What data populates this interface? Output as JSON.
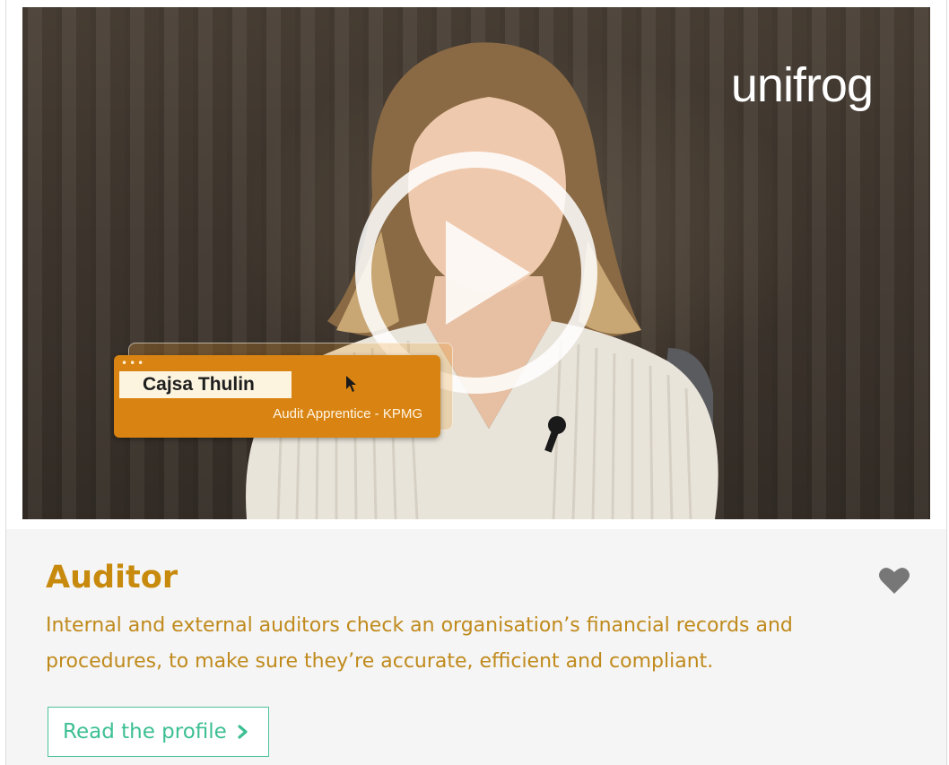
{
  "video": {
    "brand_logo": "unifrog",
    "lower_third": {
      "name": "Cajsa Thulin",
      "role": "Audit Apprentice - KPMG",
      "accent_color": "#d98412"
    },
    "play_icon": "play-circle-icon"
  },
  "profile": {
    "title": "Auditor",
    "description": "Internal and external auditors check an organisation’s financial records and procedures, to make sure they’re accurate, efficient and compliant.",
    "favourite_icon": "heart-icon",
    "read_button_label": "Read the profile",
    "read_button_icon": "chevron-right-icon",
    "title_color": "#c88a0c",
    "button_color": "#3dbf94"
  }
}
